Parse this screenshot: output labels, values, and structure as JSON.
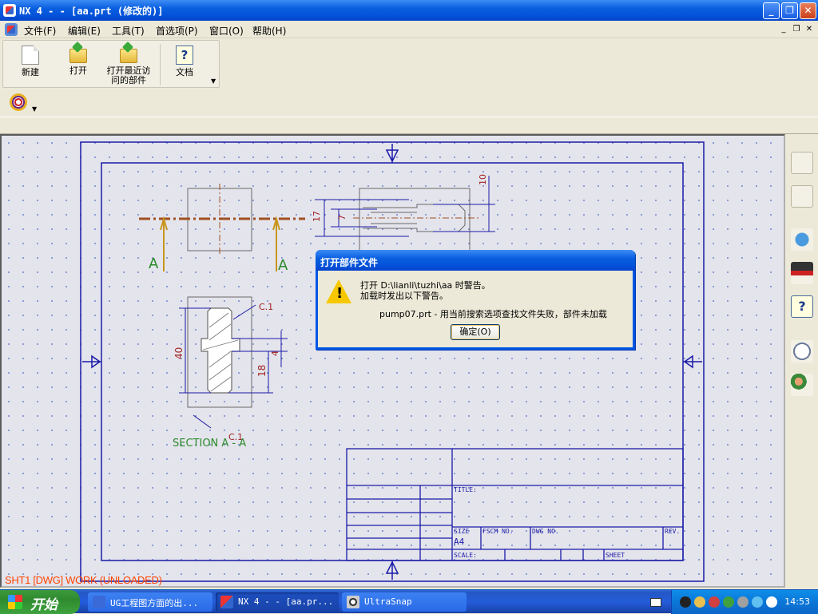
{
  "window": {
    "title": "NX 4 -  - [aa.prt (修改的)]"
  },
  "menu": {
    "items": [
      "文件(F)",
      "编辑(E)",
      "工具(T)",
      "首选项(P)",
      "窗口(O)",
      "帮助(H)"
    ]
  },
  "toolbar": {
    "new_label": "新建",
    "open_label": "打开",
    "recent_label_1": "打开最近访",
    "recent_label_2": "问的部件",
    "docs_label": "文档"
  },
  "drawing": {
    "section_a_left": "A",
    "section_a_right": "A",
    "chamfer_top": "C.1",
    "chamfer_bottom": "C.1",
    "dim_40": "40",
    "dim_18": "18",
    "dim_4": "4",
    "dim_10": "10",
    "dim_17": "17",
    "dim_7": "7",
    "section_label": "SECTION  A - A",
    "tb_title": "TITLE:",
    "tb_size": "SIZE",
    "tb_fscm": "FSCM NO.",
    "tb_dwg": "DWG NO.",
    "tb_rev": "REV.",
    "tb_a4": "A4",
    "tb_scale": "SCALE:",
    "tb_sheet": "SHEET"
  },
  "status": {
    "text": "SHT1 [DWG] WORK (UNLOADED)"
  },
  "dialog": {
    "title": "打开部件文件",
    "line1": "打开 D:\\lianli\\tuzhi\\aa 时警告。",
    "line2": "加载时发出以下警告。",
    "line3": "pump07.prt - 用当前搜索选项查找文件失败，部件未加载",
    "ok_label": "确定(O)"
  },
  "taskbar": {
    "start_label": "开始",
    "tasks": [
      "UG工程图方面的出...",
      "NX 4 -  - [aa.pr...",
      "UltraSnap"
    ],
    "clock": "14:53"
  },
  "colors": {
    "drawing_blue": "#1a1aa8",
    "geometry": "#6a6a6a",
    "centerline": "#a05020",
    "status_orange": "#ff4400"
  }
}
